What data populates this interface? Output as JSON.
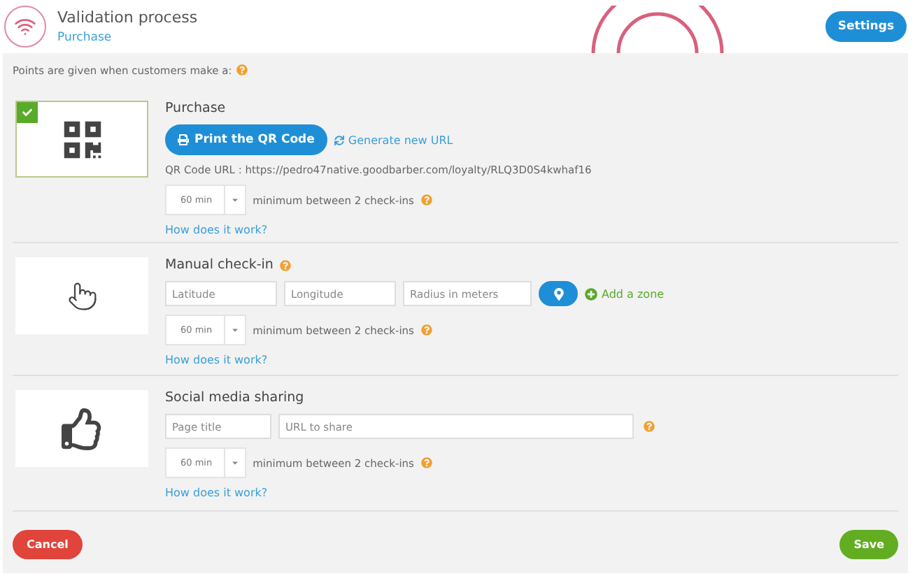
{
  "header": {
    "title": "Validation process",
    "subtitle": "Purchase",
    "settings_button": "Settings"
  },
  "intro": {
    "text": "Points are given when customers make a:",
    "help": true
  },
  "methods": [
    {
      "kind": "qr",
      "title": "Purchase",
      "selected": true,
      "print_button": "Print the QR Code",
      "generate_link": "Generate new URL",
      "url_text": "QR Code URL : https://pedro47native.goodbarber.com/loyalty/RLQ3D0S4kwhaf16",
      "interval": "60 min",
      "interval_label": "minimum between 2 check-ins",
      "interval_help": true,
      "how_link": "How does it work?"
    },
    {
      "kind": "manual",
      "title": "Manual check-in",
      "title_help": true,
      "selected": false,
      "fields": [
        {
          "placeholder": "Latitude"
        },
        {
          "placeholder": "Longitude"
        },
        {
          "placeholder": "Radius in meters"
        }
      ],
      "add_link": "Add a zone",
      "interval": "60 min",
      "interval_label": "minimum between 2 check-ins",
      "interval_help": true,
      "how_link": "How does it work?"
    },
    {
      "kind": "social",
      "title": "Social media sharing",
      "selected": false,
      "page_title": {
        "placeholder": "Page title"
      },
      "url_field": {
        "placeholder": "URL to share"
      },
      "fields_help": true,
      "interval": "60 min",
      "interval_label": "minimum between 2 check-ins",
      "interval_help": true,
      "how_link": "How does it work?"
    }
  ],
  "footer": {
    "cancel_button": "Cancel",
    "save_button": "Save"
  }
}
